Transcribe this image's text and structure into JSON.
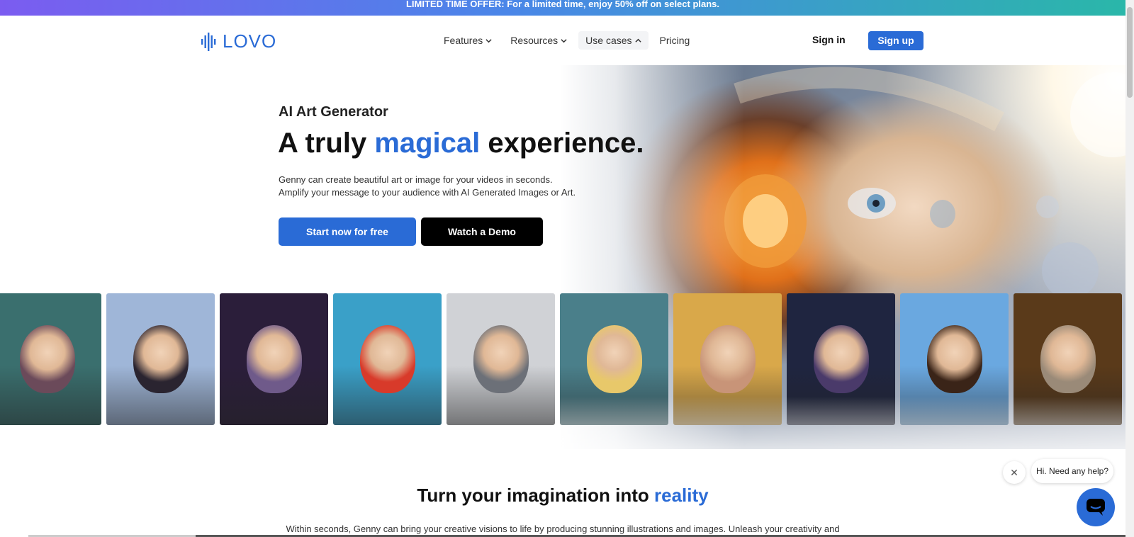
{
  "promo": {
    "text": "LIMITED TIME OFFER: For a limited time, enjoy 50% off on select plans."
  },
  "nav": {
    "logo_text": "LOVO",
    "menu": [
      {
        "label": "Features",
        "icon": "chevron-down-icon"
      },
      {
        "label": "Resources",
        "icon": "chevron-down-icon"
      },
      {
        "label": "Use cases",
        "icon": "chevron-up-icon"
      },
      {
        "label": "Pricing"
      }
    ],
    "sign_in": "Sign in",
    "sign_up": "Sign up"
  },
  "hero": {
    "eyebrow": "AI Art Generator",
    "title_pre": "A truly ",
    "title_accent": "magical",
    "title_post": " experience.",
    "desc_line1": "Genny can create beautiful art or image for your videos in seconds.",
    "desc_line2": "Amplify your message to your audience with AI Generated Images or Art.",
    "cta_primary": "Start now for free",
    "cta_secondary": "Watch a Demo"
  },
  "gallery": [
    {
      "name": "cyberpunk-warrior",
      "bg": "#3a6f6e",
      "head": "#6b4a5a"
    },
    {
      "name": "anime-girl-sea",
      "bg": "#9fb6d8",
      "head": "#2a2430"
    },
    {
      "name": "purple-hair-girl",
      "bg": "#2b1e3a",
      "head": "#6f5a8a"
    },
    {
      "name": "red-hair-mermaid",
      "bg": "#3aa0c8",
      "head": "#d83a2a"
    },
    {
      "name": "silver-robot",
      "bg": "#d0d2d6",
      "head": "#6c7078"
    },
    {
      "name": "blonde-girl",
      "bg": "#4a7f8a",
      "head": "#e8c86a"
    },
    {
      "name": "smiling-old-man",
      "bg": "#d9a84a",
      "head": "#c89478"
    },
    {
      "name": "witch-with-candle",
      "bg": "#1f2540",
      "head": "#4a3a6a"
    },
    {
      "name": "smiling-woman",
      "bg": "#6aa8e0",
      "head": "#3a2418"
    },
    {
      "name": "royal-cat",
      "bg": "#5a3a1a",
      "head": "#9a8a78"
    }
  ],
  "section2": {
    "title_pre": "Turn your imagination into ",
    "title_accent": "reality",
    "desc": "Within seconds, Genny can bring your creative visions to life by producing stunning illustrations and images. Unleash your creativity and"
  },
  "chat": {
    "bubble_text": "Hi. Need any help?",
    "close_icon": "close-icon",
    "button_icon": "chat-icon"
  },
  "colors": {
    "accent": "#2a6bd6",
    "dark_button": "#000000"
  }
}
